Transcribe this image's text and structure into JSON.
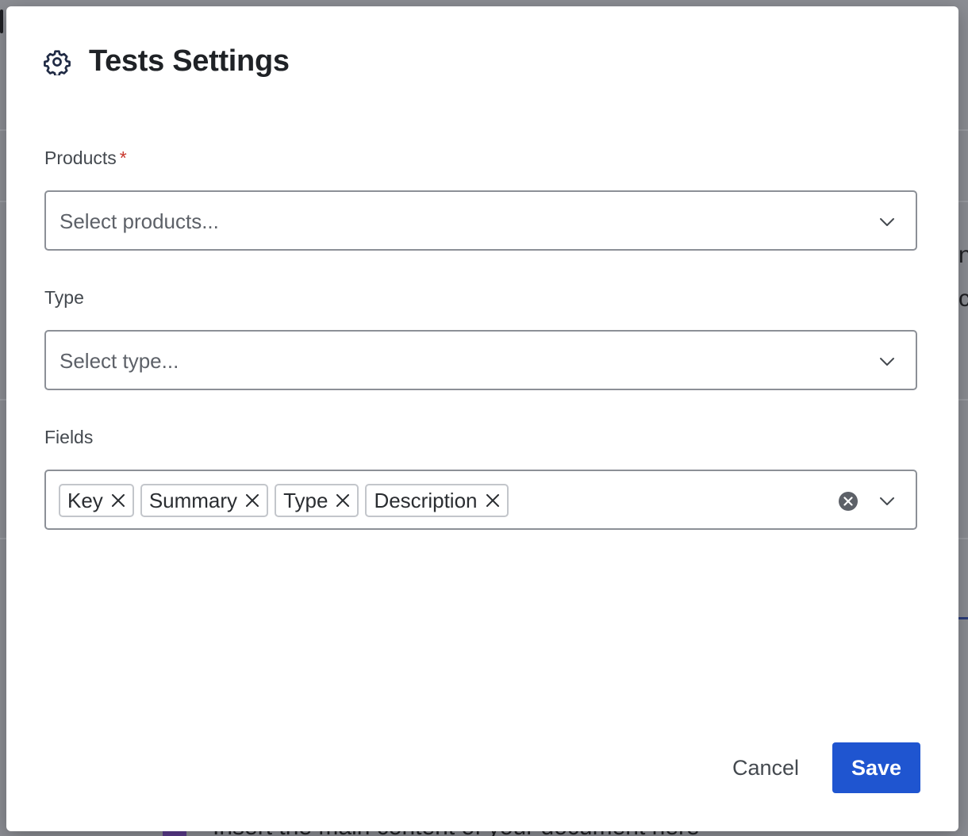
{
  "dialog": {
    "title": "Tests Settings",
    "title_icon": "gear-icon"
  },
  "products": {
    "label": "Products",
    "required_marker": "*",
    "placeholder": "Select products..."
  },
  "type": {
    "label": "Type",
    "placeholder": "Select type..."
  },
  "fields": {
    "label": "Fields",
    "tags": [
      {
        "label": "Key"
      },
      {
        "label": "Summary"
      },
      {
        "label": "Type"
      },
      {
        "label": "Description"
      }
    ]
  },
  "footer": {
    "cancel_label": "Cancel",
    "save_label": "Save"
  },
  "background": {
    "right_char_1": "n",
    "right_char_2": "c",
    "doc_text": "Insert the main content of your document here"
  },
  "colors": {
    "primary": "#1f55d0",
    "required": "#c9372c",
    "overlay": "#8b8d93"
  }
}
